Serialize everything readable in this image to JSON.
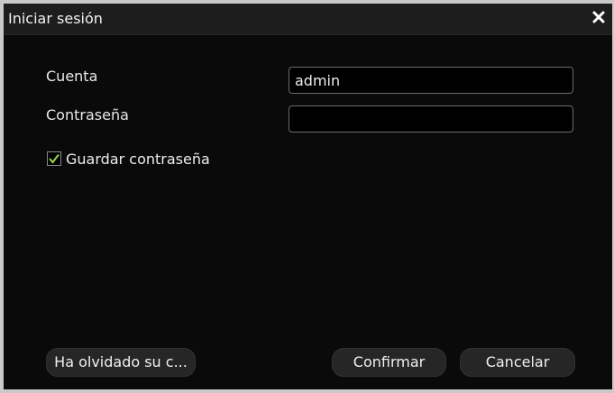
{
  "dialog": {
    "title": "Iniciar sesión",
    "close_icon": "close-icon",
    "close_glyph": "✕"
  },
  "form": {
    "account_label": "Cuenta",
    "account_value": "admin",
    "password_label": "Contraseña",
    "password_value": "",
    "save_password_label": "Guardar contraseña",
    "save_password_checked": true,
    "check_icon": "checkmark-icon"
  },
  "buttons": {
    "forgot_label": "Ha olvidado su c...",
    "confirm_label": "Confirmar",
    "cancel_label": "Cancelar"
  },
  "colors": {
    "background": "#0a0a0a",
    "titlebar": "#1d1d1d",
    "check_accent": "#9bd94a",
    "button": "#262626"
  }
}
